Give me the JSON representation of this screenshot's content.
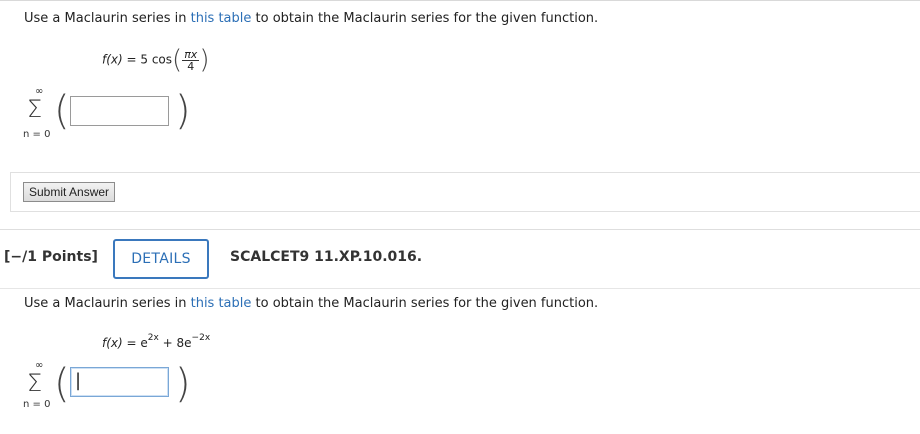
{
  "question1": {
    "prompt_before": "Use a Maclaurin series in ",
    "prompt_link": "this table",
    "prompt_after": " to obtain the Maclaurin series for the given function.",
    "func_lhs": "f(x)",
    "func_eq": " = 5 cos",
    "frac_num": "πx",
    "frac_den": "4",
    "sum_upper": "∞",
    "sum_lower": "n = 0",
    "answer_value": "",
    "submit_label": "Submit Answer"
  },
  "question2": {
    "points_label": "[−/1 Points]",
    "details_label": "DETAILS",
    "code_label": "SCALCET9 11.XP.10.016.",
    "prompt_before": "Use a Maclaurin series in ",
    "prompt_link": "this table",
    "prompt_after": " to obtain the Maclaurin series for the given function.",
    "func_lhs": "f(x)",
    "func_eq": " = e",
    "exp1": "2x",
    "func_mid": " + 8e",
    "exp2": "−2x",
    "sum_upper": "∞",
    "sum_lower": "n = 0",
    "answer_value": "|"
  }
}
